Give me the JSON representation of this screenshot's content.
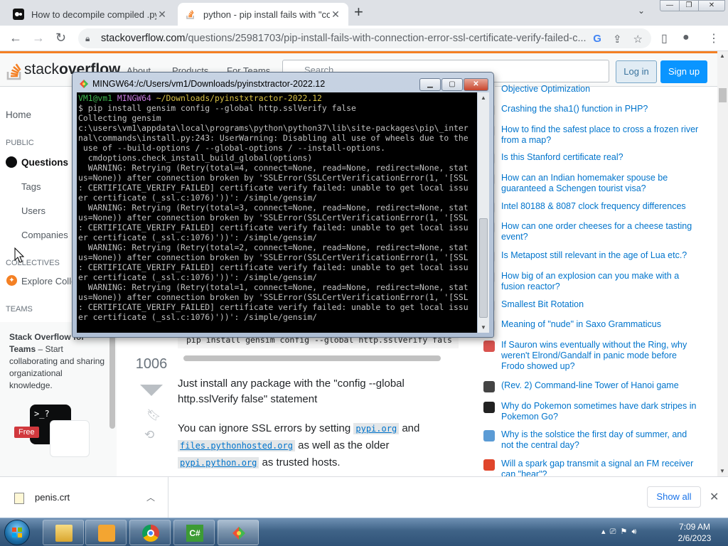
{
  "browser": {
    "tabs": [
      {
        "title": "How to decompile compiled .pyc",
        "close": "✕"
      },
      {
        "title": "python - pip install fails with \"co",
        "close": "✕"
      }
    ],
    "new_tab": "+",
    "tab_menu": "⌄",
    "window_controls": {
      "minimize": "—",
      "maximize": "❐",
      "close": "✕"
    },
    "nav": {
      "back": "←",
      "forward": "→",
      "reload": "↻"
    },
    "url_host": "stackoverflow.com",
    "url_path": "/questions/25981703/pip-install-fails-with-connection-error-ssl-certificate-verify-failed-c..."
  },
  "so": {
    "logo_left": "stack",
    "logo_right": "overflow",
    "nav": [
      "About",
      "Products",
      "For Teams"
    ],
    "search_placeholder": "Search…",
    "login": "Log in",
    "signup": "Sign up",
    "leftnav": {
      "home": "Home",
      "public": "PUBLIC",
      "questions": "Questions",
      "tags": "Tags",
      "users": "Users",
      "companies": "Companies",
      "collectives": "COLLECTIVES",
      "explore": "Explore Colle",
      "teams": "TEAMS"
    },
    "teams_box": {
      "title": "Stack Overflow for Teams",
      "body": " – Start collaborating and sharing organizational knowledge.",
      "badge": "Free"
    },
    "post": {
      "vote_count": "1006",
      "code_line": "pip install gensim config --global http.sslVerify fals",
      "para1": "Just install any package with the \"config --global http.sslVerify false\" statement",
      "para2_a": "You can ignore SSL errors by setting ",
      "para2_code1": "pypi.org",
      "para2_b": " and ",
      "para2_code2": "files.pythonhosted.org",
      "para2_c": " as well as the older ",
      "para2_code3": "pypi.python.org",
      "para2_d": " as trusted hosts."
    },
    "hot_questions": [
      {
        "title": "Objective Optimization",
        "color": "#ffffff"
      },
      {
        "title": "Crashing the sha1() function in PHP?",
        "color": "#e8e8e8"
      },
      {
        "title": "How to find the safest place to cross a frozen river from a map?",
        "color": "#e8e8e8"
      },
      {
        "title": "Is this Stanford certificate real?",
        "color": "#e8e8e8"
      },
      {
        "title": "How can an Indian homemaker spouse be guaranteed a Schengen tourist visa?",
        "color": "#e8e8e8"
      },
      {
        "title": "Intel 80188 & 8087 clock frequency differences",
        "color": "#e8e8e8"
      },
      {
        "title": "How can one order cheeses for a cheese tasting event?",
        "color": "#e8e8e8"
      },
      {
        "title": "Is Metapost still relevant in the age of Lua etc.?",
        "color": "#e8e8e8"
      },
      {
        "title": "How big of an explosion can you make with a fusion reactor?",
        "color": "#e8e8e8"
      },
      {
        "title": "Smallest Bit Rotation",
        "color": "#e8e8e8"
      },
      {
        "title": "Meaning of \"nude\" in Saxo Grammaticus",
        "color": "#e8e8e8"
      },
      {
        "title": "If Sauron wins eventually without the Ring, why weren't Elrond/Gandalf in panic mode before Frodo showed up?",
        "color": "#d9534f"
      },
      {
        "title": "(Rev. 2) Command-line Tower of Hanoi game",
        "color": "#444444"
      },
      {
        "title": "Why do Pokemon sometimes have dark stripes in Pokemon Go?",
        "color": "#222222"
      },
      {
        "title": "Why is the solstice the first day of summer, and not the central day?",
        "color": "#5b9bd5"
      },
      {
        "title": "Will a spark gap transmit a signal an FM receiver can \"hear\"?",
        "color": "#e0452b"
      }
    ]
  },
  "mingw": {
    "title": "MINGW64:/c/Users/vm1/Downloads/pyinstxtractor-2022.12",
    "prompt_user": "VM1@vm1",
    "prompt_host": "MINGW64",
    "prompt_path": "~/Downloads/pyinstxtractor-2022.12",
    "output": "$ pip install gensim config --global http.sslVerify false\nCollecting gensim\nc:\\users\\vm1\\appdata\\local\\programs\\python\\python37\\lib\\site-packages\\pip\\_inter\nnal\\commands\\install.py:243: UserWarning: Disabling all use of wheels due to the\n use of --build-options / --global-options / --install-options.\n  cmdoptions.check_install_build_global(options)\n  WARNING: Retrying (Retry(total=4, connect=None, read=None, redirect=None, stat\nus=None)) after connection broken by 'SSLError(SSLCertVerificationError(1, '[SSL\n: CERTIFICATE_VERIFY_FAILED] certificate verify failed: unable to get local issu\ner certificate (_ssl.c:1076)'))': /simple/gensim/\n  WARNING: Retrying (Retry(total=3, connect=None, read=None, redirect=None, stat\nus=None)) after connection broken by 'SSLError(SSLCertVerificationError(1, '[SSL\n: CERTIFICATE_VERIFY_FAILED] certificate verify failed: unable to get local issu\ner certificate (_ssl.c:1076)'))': /simple/gensim/\n  WARNING: Retrying (Retry(total=2, connect=None, read=None, redirect=None, stat\nus=None)) after connection broken by 'SSLError(SSLCertVerificationError(1, '[SSL\n: CERTIFICATE_VERIFY_FAILED] certificate verify failed: unable to get local issu\ner certificate (_ssl.c:1076)'))': /simple/gensim/\n  WARNING: Retrying (Retry(total=1, connect=None, read=None, redirect=None, stat\nus=None)) after connection broken by 'SSLError(SSLCertVerificationError(1, '[SSL\n: CERTIFICATE_VERIFY_FAILED] certificate verify failed: unable to get local issu\ner certificate (_ssl.c:1076)'))': /simple/gensim/"
  },
  "downloads": {
    "file": "penis.crt",
    "show_all": "Show all"
  },
  "taskbar": {
    "time": "7:09 AM",
    "date": "2/6/2023"
  }
}
